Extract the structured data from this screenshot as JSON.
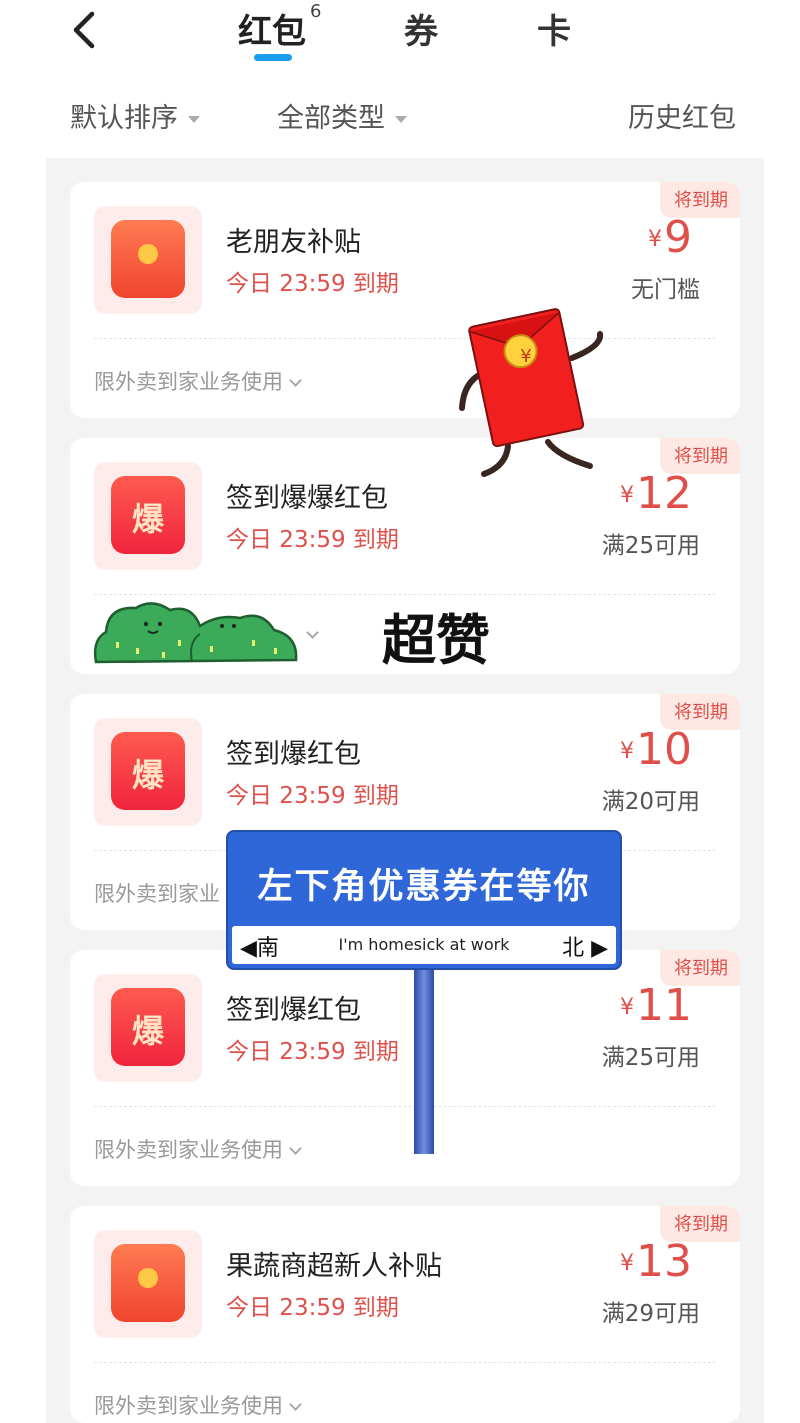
{
  "header": {
    "tabs": [
      {
        "label": "红包",
        "count": "6"
      },
      {
        "label": "券"
      },
      {
        "label": "卡"
      }
    ]
  },
  "filters": {
    "sort": "默认排序",
    "type": "全部类型",
    "history": "历史红包"
  },
  "cards": [
    {
      "tag": "将到期",
      "title": "老朋友补贴",
      "expiry": "今日 23:59 到期",
      "currency": "¥",
      "amount": "9",
      "condition": "无门槛",
      "scope": "限外卖到家业务使用",
      "icon": "red-envelope-icon"
    },
    {
      "tag": "将到期",
      "title": "签到爆爆红包",
      "expiry": "今日 23:59 到期",
      "currency": "¥",
      "amount": "12",
      "condition": "满25可用",
      "scope": "",
      "icon": "bao-icon",
      "icon_char": "爆"
    },
    {
      "tag": "将到期",
      "title": "签到爆红包",
      "expiry": "今日 23:59 到期",
      "currency": "¥",
      "amount": "10",
      "condition": "满20可用",
      "scope": "限外卖到家业",
      "icon": "bao-icon",
      "icon_char": "爆"
    },
    {
      "tag": "将到期",
      "title": "签到爆红包",
      "expiry": "今日 23:59 到期",
      "currency": "¥",
      "amount": "11",
      "condition": "满25可用",
      "scope": "限外卖到家业务使用",
      "icon": "bao-icon",
      "icon_char": "爆"
    },
    {
      "tag": "将到期",
      "title": "果蔬商超新人补贴",
      "expiry": "今日 23:59 到期",
      "currency": "¥",
      "amount": "13",
      "condition": "满29可用",
      "scope": "限外卖到家业务使用",
      "icon": "red-envelope-icon"
    }
  ],
  "stickers": {
    "praise_text": "超赞",
    "sign": {
      "headline": "左下角优惠券在等你",
      "south": "◀南",
      "north": "北 ▶",
      "subtitle": "I'm homesick at work"
    },
    "envelope_symbol": "¥"
  },
  "colors": {
    "accent_red": "#e0504a",
    "tab_indicator": "#1b9df0",
    "sign_blue": "#2f67d8"
  }
}
